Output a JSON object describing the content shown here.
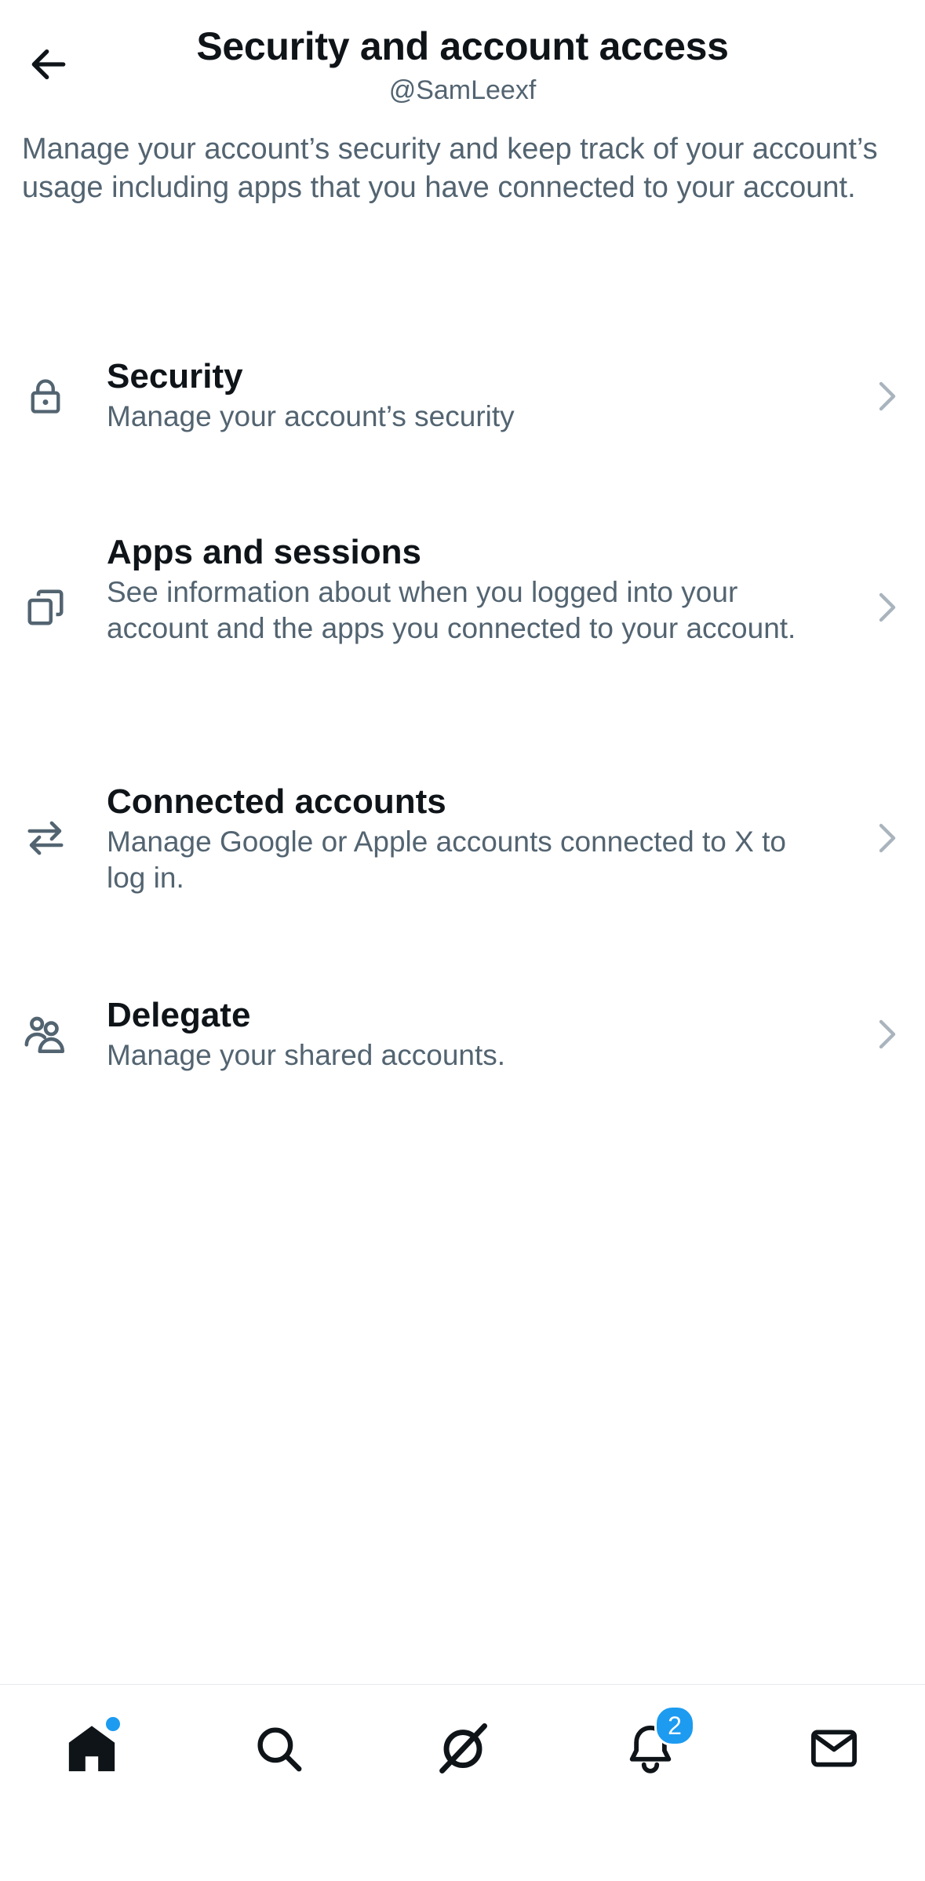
{
  "header": {
    "title": "Security and account access",
    "handle": "@SamLeexf",
    "back_icon": "arrow-left-icon"
  },
  "description": "Manage your account’s security and keep track of your account’s usage including apps that you have connected to your account.",
  "items": [
    {
      "icon": "lock-icon",
      "title": "Security",
      "subtitle": "Manage your account’s security"
    },
    {
      "icon": "windows-icon",
      "title": "Apps and sessions",
      "subtitle": "See information about when you logged into your account and the apps you connected to your account."
    },
    {
      "icon": "swap-arrows-icon",
      "title": "Connected accounts",
      "subtitle": "Manage Google or Apple accounts connected to X to log in."
    },
    {
      "icon": "people-icon",
      "title": "Delegate",
      "subtitle": "Manage your shared accounts."
    }
  ],
  "tabbar": {
    "tabs": [
      {
        "name": "home",
        "icon": "home-icon",
        "active": true,
        "has_dot": true
      },
      {
        "name": "search",
        "icon": "search-icon"
      },
      {
        "name": "grok",
        "icon": "grok-icon"
      },
      {
        "name": "notifications",
        "icon": "bell-icon",
        "badge": "2"
      },
      {
        "name": "messages",
        "icon": "mail-icon"
      }
    ]
  },
  "colors": {
    "text_primary": "#0f1419",
    "text_secondary": "#536471",
    "accent": "#1d9bf0",
    "chevron": "#a9b4bd"
  }
}
